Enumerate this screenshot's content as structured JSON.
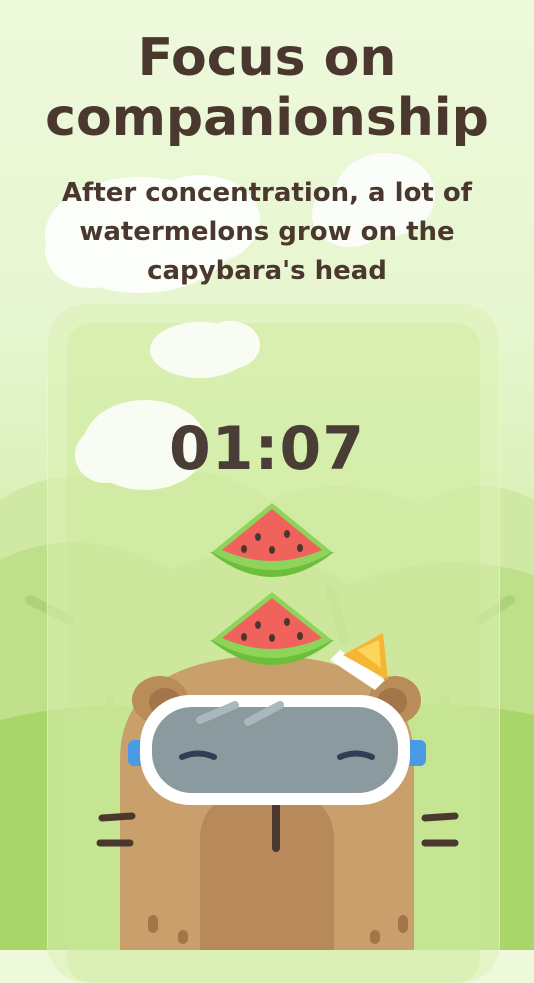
{
  "headline": {
    "line1": "Focus on",
    "line2": "companionship"
  },
  "subline": {
    "line1": "After concentration, a lot of",
    "line2": "watermelons grow on the",
    "line3": "capybara's head"
  },
  "timer": {
    "value": "01:07"
  },
  "illustration": {
    "character": "capybara-icon",
    "accessories": [
      "swim-goggles-icon",
      "watermelon-slice-icon",
      "watermelon-slice-icon",
      "popsicle-icon"
    ]
  },
  "colors": {
    "text": "#4a372d",
    "capybara": "#c9a06c",
    "watermelon_flesh": "#f0625c",
    "watermelon_rind": "#7fc34a",
    "background": "#e6f6cf"
  }
}
